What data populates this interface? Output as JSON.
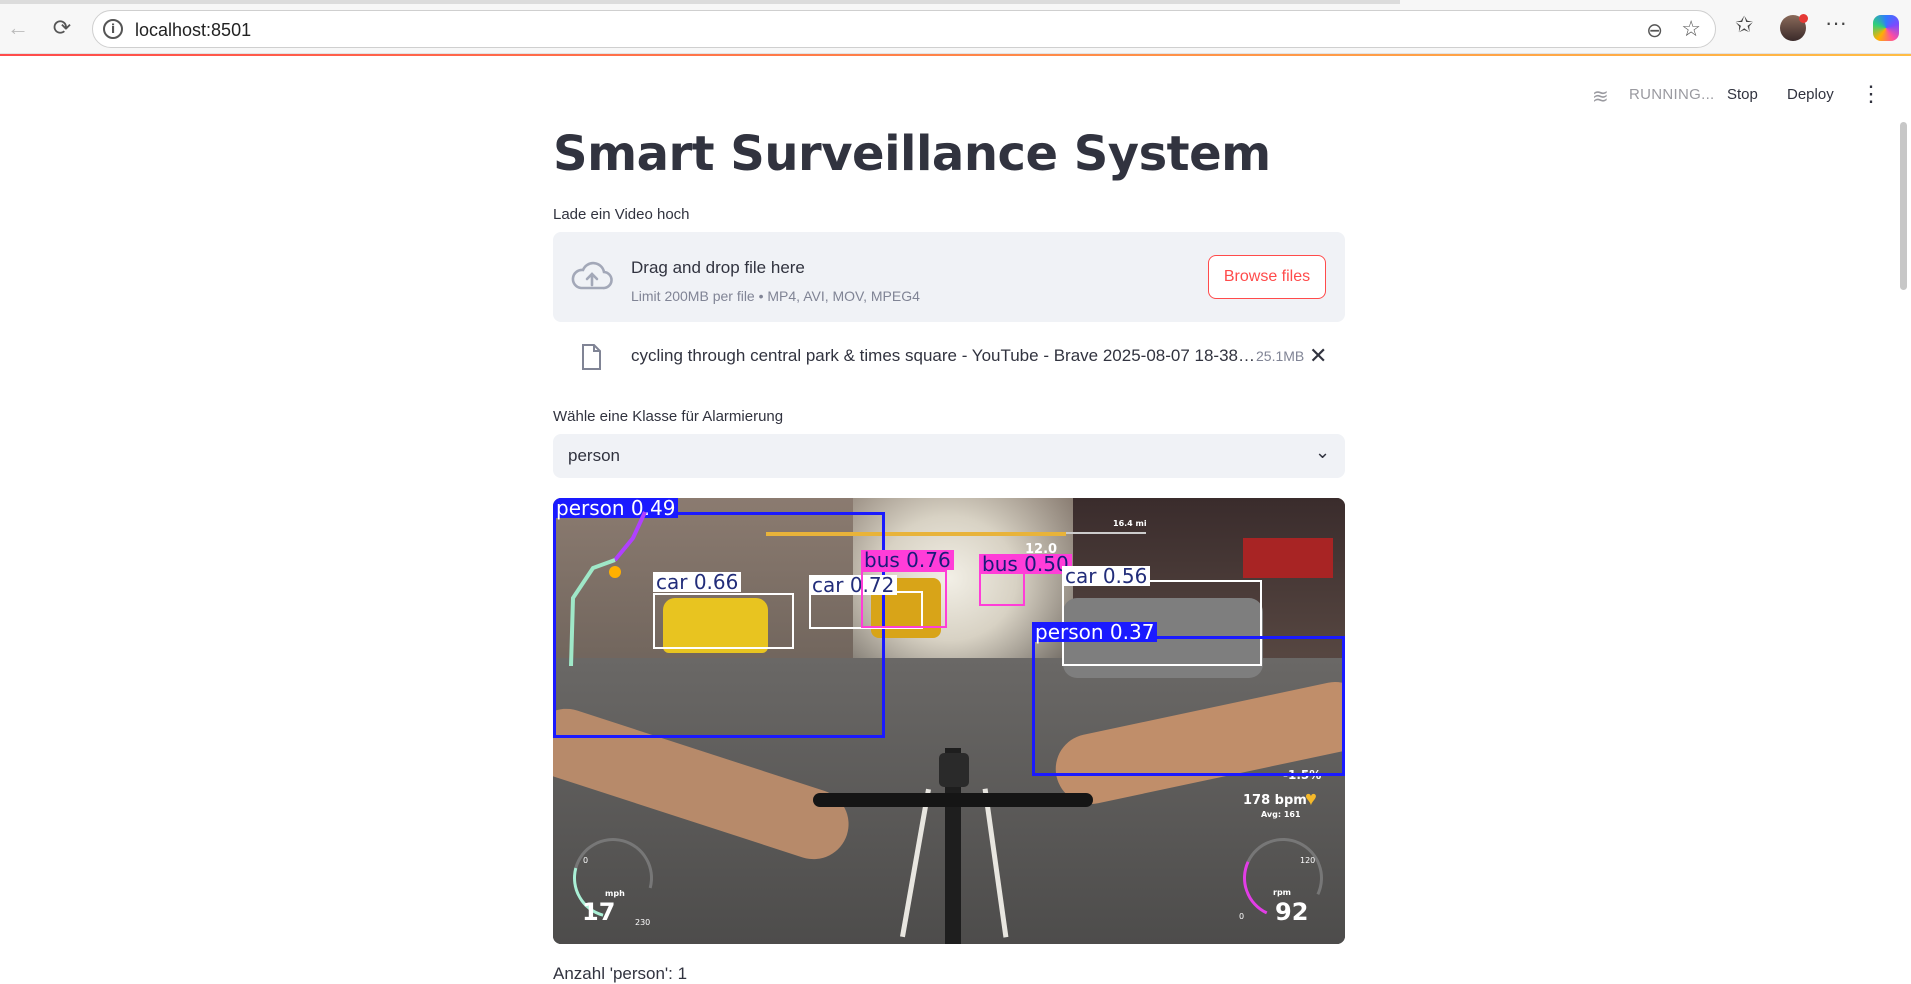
{
  "browser": {
    "url": "localhost:8501"
  },
  "header": {
    "status": "RUNNING...",
    "stop_label": "Stop",
    "deploy_label": "Deploy"
  },
  "main": {
    "title": "Smart Surveillance System",
    "uploader": {
      "label": "Lade ein Video hoch",
      "drop_text": "Drag and drop file here",
      "limit_text": "Limit 200MB per file • MP4, AVI, MOV, MPEG4",
      "browse_label": "Browse files",
      "file_name": "cycling through central park & times square - YouTube - Brave 2025-08-07 18-38-...",
      "file_size": "25.1MB"
    },
    "select": {
      "label": "Wähle eine Klasse für Alarmierung",
      "value": "person"
    },
    "video": {
      "detections": [
        {
          "label": "person 0.49",
          "color": "#1a1aff"
        },
        {
          "label": "car 0.66",
          "color": "#ffffff"
        },
        {
          "label": "car 0.72",
          "color": "#ffffff"
        },
        {
          "label": "bus 0.76",
          "color": "#ff3dd8"
        },
        {
          "label": "bus 0.50",
          "color": "#ff3dd8"
        },
        {
          "label": "car 0.56",
          "color": "#ffffff"
        },
        {
          "label": "person 0.37",
          "color": "#1a1aff"
        }
      ],
      "hud": {
        "distance": "16.4 mi",
        "elevation": "12.0",
        "grade": "-1.5%",
        "heart_rate": "178 bpm",
        "heart_avg": "Avg: 161",
        "speed_min": "0",
        "speed_max": "230",
        "speed_unit": "mph",
        "speed_value": "17",
        "cadence_min": "0",
        "cadence_max": "120",
        "cadence_unit": "rpm",
        "cadence_value": "92"
      }
    },
    "count_text": "Anzahl 'person': 1"
  }
}
